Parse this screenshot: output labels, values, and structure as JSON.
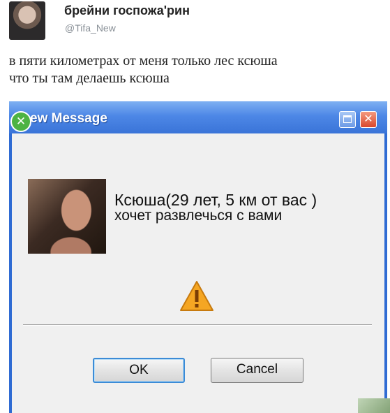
{
  "tweet": {
    "display_name": "брейни госпожа'рин",
    "handle": "@Tifa_New",
    "text_lines": [
      "в пяти километрах от меня только лес ксюша",
      "что ты там делаешь ксюша"
    ]
  },
  "dialog": {
    "title_icon_glyph": "✕",
    "title": "ew Message",
    "close_glyph": "✕",
    "message_line1": "Ксюша(29 лет, 5 км от вас )",
    "message_line2": "хочет развлечься с вами",
    "ok_label": "OK",
    "cancel_label": "Cancel"
  },
  "colors": {
    "title_bar": "#3a74d8",
    "warning": "#f5a623",
    "accent_border": "#3c8bd6"
  }
}
